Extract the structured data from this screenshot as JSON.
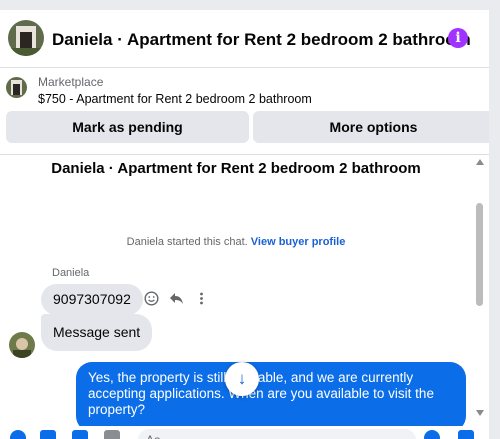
{
  "header": {
    "title": "Daniela · Apartment for Rent 2 bedroom 2 bathroom"
  },
  "marketplace": {
    "label": "Marketplace",
    "description": "$750 - Apartment for Rent 2 bedroom 2 bathroom",
    "pending_button": "Mark as pending",
    "more_button": "More options"
  },
  "chat": {
    "title": "Daniela · Apartment for Rent 2 bedroom 2 bathroom",
    "system_text": "Daniela started this chat.",
    "system_link": "View buyer profile",
    "sender_name": "Daniela",
    "messages": [
      {
        "text": "9097307092"
      },
      {
        "text": "Message sent"
      },
      {
        "text": "Yes, the property is still available, and we are currently accepting applications. When are you available to visit the property?"
      }
    ]
  },
  "composer": {
    "placeholder": "Aa"
  },
  "colors": {
    "accent": "#0b6ee8",
    "info": "#a033ff"
  }
}
